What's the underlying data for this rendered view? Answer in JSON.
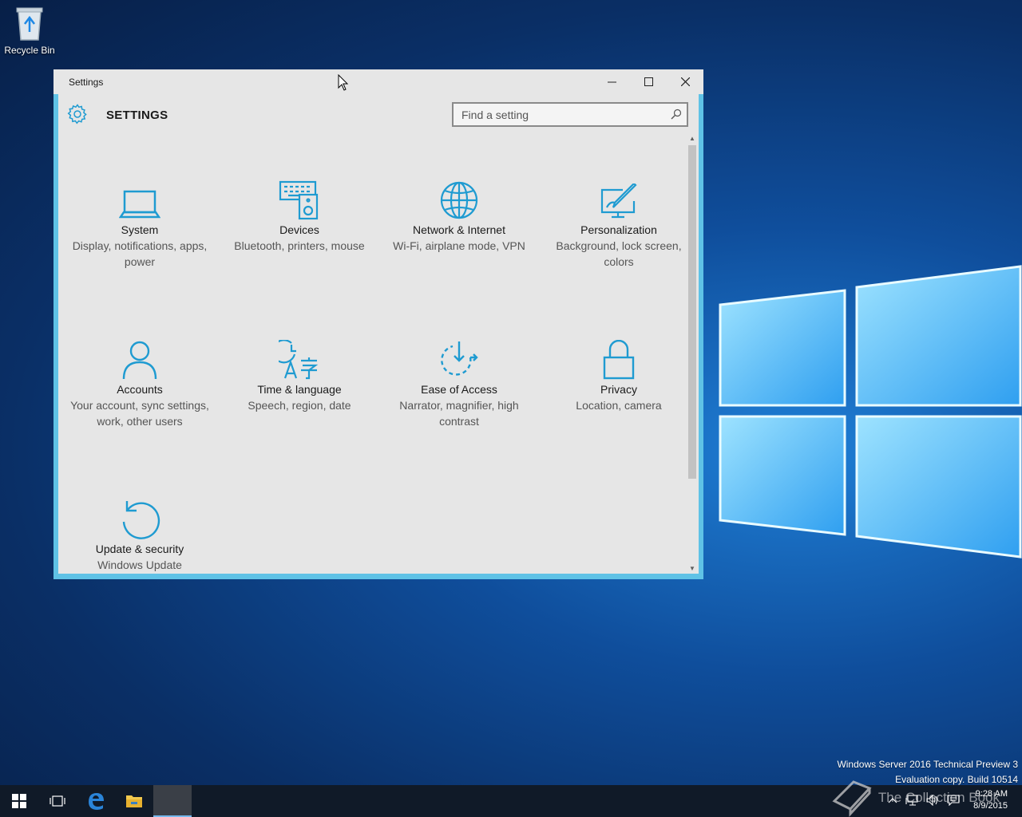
{
  "desktop": {
    "recycle_bin_label": "Recycle Bin",
    "watermark_line1": "Windows Server 2016 Technical Preview 3",
    "watermark_line2": "Evaluation copy. Build 10514"
  },
  "window": {
    "title": "Settings",
    "app_title": "SETTINGS",
    "search_placeholder": "Find a setting",
    "accent_color": "#1f9bd1"
  },
  "tiles": [
    {
      "name": "System",
      "desc": "Display, notifications, apps, power",
      "icon": "laptop-icon"
    },
    {
      "name": "Devices",
      "desc": "Bluetooth, printers, mouse",
      "icon": "devices-icon"
    },
    {
      "name": "Network & Internet",
      "desc": "Wi-Fi, airplane mode, VPN",
      "icon": "globe-icon"
    },
    {
      "name": "Personalization",
      "desc": "Background, lock screen, colors",
      "icon": "paint-icon"
    },
    {
      "name": "Accounts",
      "desc": "Your account, sync settings, work, other users",
      "icon": "person-icon"
    },
    {
      "name": "Time & language",
      "desc": "Speech, region, date",
      "icon": "time-language-icon"
    },
    {
      "name": "Ease of Access",
      "desc": "Narrator, magnifier, high contrast",
      "icon": "ease-of-access-icon"
    },
    {
      "name": "Privacy",
      "desc": "Location, camera",
      "icon": "lock-icon"
    },
    {
      "name": "Update & security",
      "desc": "Windows Update",
      "icon": "update-icon"
    }
  ],
  "taskbar": {
    "clock_time": "9:28 AM",
    "clock_date": "8/9/2015",
    "watermark_text": "The Collection Book"
  }
}
